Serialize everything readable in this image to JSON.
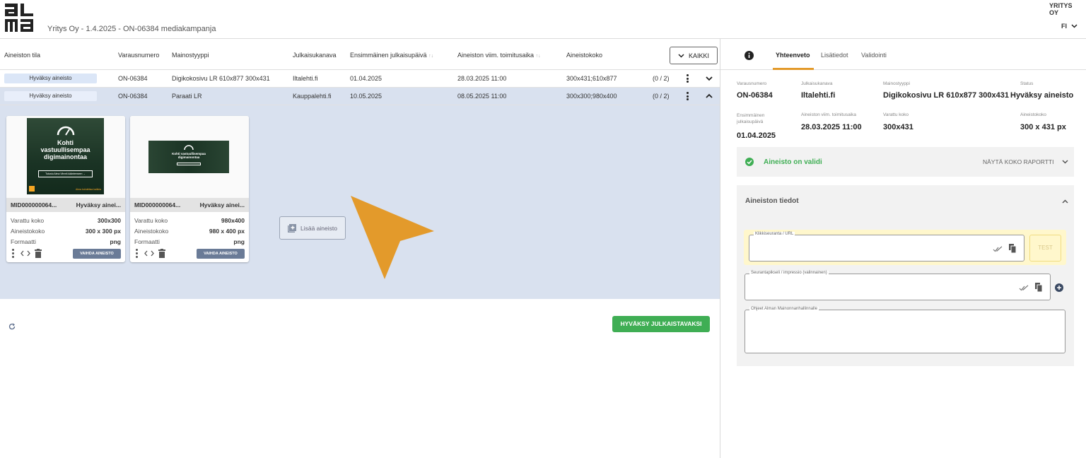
{
  "header": {
    "logo_text": "alma",
    "breadcrumb": "Yritys Oy - 1.4.2025 - ON-06384 mediakampanja",
    "company": "YRITYS OY",
    "language": "FI"
  },
  "table": {
    "columns": [
      "Aineiston tila",
      "Varausnumero",
      "Mainostyyppi",
      "Julkaisukanava",
      "Ensimmäinen julkaisupäivä",
      "Aineiston viim. toimitusaika",
      "Aineistokoko"
    ],
    "sort_indicator": "↑↓",
    "filter_label": "KAIKKI",
    "rows": [
      {
        "status": "Hyväksy aineisto",
        "varaus": "ON-06384",
        "tyyppi": "Digikokosivu LR 610x877 300x431",
        "kanava": "Iltalehti.fi",
        "julkaisu": "01.04.2025",
        "toimitus": "28.03.2025 11:00",
        "koko": "300x431;610x877",
        "count": "(0 / 2)"
      },
      {
        "status": "Hyväksy aineisto",
        "varaus": "ON-06384",
        "tyyppi": "Paraati LR",
        "kanava": "Kauppalehti.fi",
        "julkaisu": "10.05.2025",
        "toimitus": "08.05.2025 11:00",
        "koko": "300x300;980x400",
        "count": "(0 / 2)"
      }
    ]
  },
  "cards": [
    {
      "id": "MID000000064...",
      "status": "Hyväksy ainei...",
      "labels": [
        "Varattu koko",
        "Aineistokoko",
        "Formaatti"
      ],
      "values": [
        "300x300",
        "300 x 300 px",
        "png"
      ],
      "button": "VAIHDA AINEISTO",
      "ad_line1": "Kohti",
      "ad_line2": "vastuullisempaa",
      "ad_line3": "digimainontaa",
      "ad_cta": "Tutustu Alma Vihreä käänteeseen →",
      "ad_footer": "Alma kohdettaa kaikkia"
    },
    {
      "id": "MID000000064...",
      "status": "Hyväksy ainei...",
      "labels": [
        "Varattu koko",
        "Aineistokoko",
        "Formaatti"
      ],
      "values": [
        "980x400",
        "980 x 400 px",
        "png"
      ],
      "button": "VAIHDA AINEISTO",
      "ad_line1": "Kohti vastuullisempaa",
      "ad_line2": "digimainontaa"
    }
  ],
  "add_material": "Lisää aineisto",
  "approve_button": "HYVÄKSY JULKAISTAVAKSI",
  "right": {
    "tabs": [
      "Yhteenveto",
      "Lisätiedot",
      "Validointi"
    ],
    "summary": {
      "labels": [
        "Varausnumero",
        "Julkaisukanava",
        "Mainostyyppi",
        "Status",
        "Ensimmäinen julkaisupäivä",
        "Aineiston viim. toimitusaika",
        "Varattu koko",
        "Aineistokoko"
      ],
      "values": [
        "ON-06384",
        "Iltalehti.fi",
        "Digikokosivu LR 610x877 300x431",
        "Hyväksy aineisto",
        "01.04.2025",
        "28.03.2025 11:00",
        "300x431",
        "300 x 431 px"
      ]
    },
    "valid_text": "Aineisto on validi",
    "report_link": "NÄYTÄ KOKO RAPORTTI",
    "details_title": "Aineiston tiedot",
    "fields": [
      "Klikkiseuranta / URL",
      "Seurantapikseli / impressio (valinnainen)",
      "Ohjeet Alman Mainonnanhallinnalle"
    ],
    "test_button": "TEST"
  },
  "colors": {
    "green": "#3fae54",
    "orange_cursor": "#e39a2b",
    "selected_row": "#d9e1ef"
  }
}
